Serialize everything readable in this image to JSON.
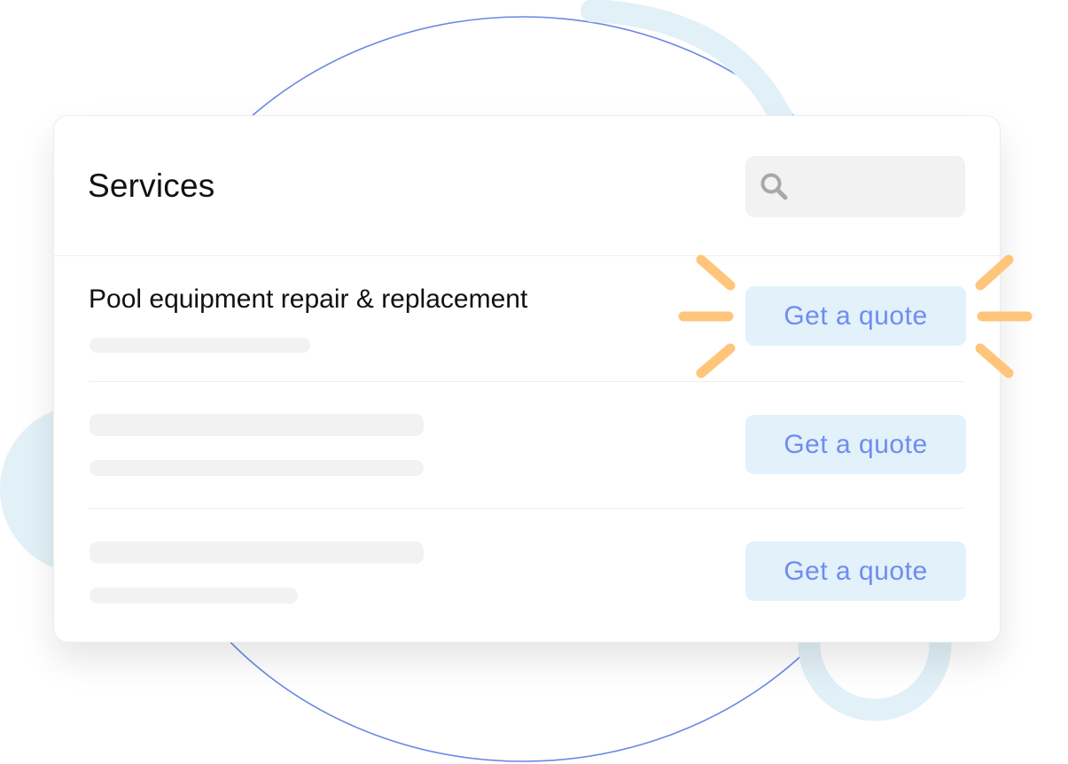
{
  "services_card": {
    "title": "Services",
    "search": {
      "placeholder": ""
    },
    "featured_service": {
      "name": "Pool equipment repair & replacement"
    },
    "quote_buttons": [
      {
        "label": "Get a quote",
        "highlighted": true
      },
      {
        "label": "Get a quote",
        "highlighted": false
      },
      {
        "label": "Get a quote",
        "highlighted": false
      }
    ]
  },
  "colors": {
    "accent_text": "#6f8cf0",
    "button_bg": "#e2f1fa",
    "sparkle": "#ffc57a",
    "ellipse_line": "#6a88e6",
    "decor_blue": "#e2f0f8"
  },
  "icons": {
    "search": "search-icon",
    "sparkle": "highlight-sparkle-icon"
  }
}
